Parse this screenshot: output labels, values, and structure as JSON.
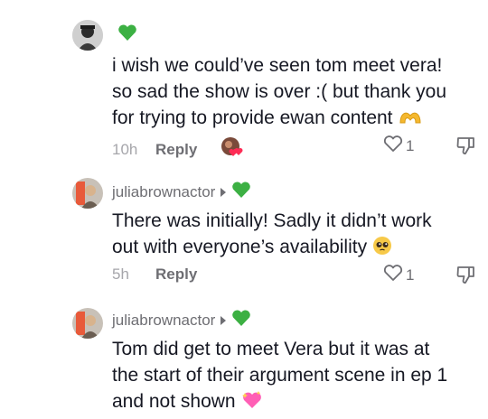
{
  "comments": [
    {
      "username": "",
      "badge_icon": "green-heart",
      "text_lines": [
        "i wish we could’ve seen tom meet vera!",
        "so sad the show is over :( but thank you",
        "for trying to provide ewan content"
      ],
      "text_emoji": "heart-hands",
      "time": "10h",
      "reply_label": "Reply",
      "likes": "1",
      "creator_liked": true
    },
    {
      "username": "juliabrownactor",
      "badge_icon": "green-heart",
      "text_lines": [
        "There was initially! Sadly it didn’t work",
        "out with everyone’s availability"
      ],
      "text_emoji": "pleading-face",
      "time": "5h",
      "reply_label": "Reply",
      "likes": "1"
    },
    {
      "username": "juliabrownactor",
      "badge_icon": "green-heart",
      "text_lines": [
        "Tom did get to meet Vera but it was at",
        "the start of their argument scene in ep 1",
        "and not shown"
      ],
      "text_emoji": "sparkling-heart"
    }
  ],
  "colors": {
    "green_heart": "#3cb043",
    "muted": "#a6a6ab",
    "username": "#6e6e73"
  }
}
